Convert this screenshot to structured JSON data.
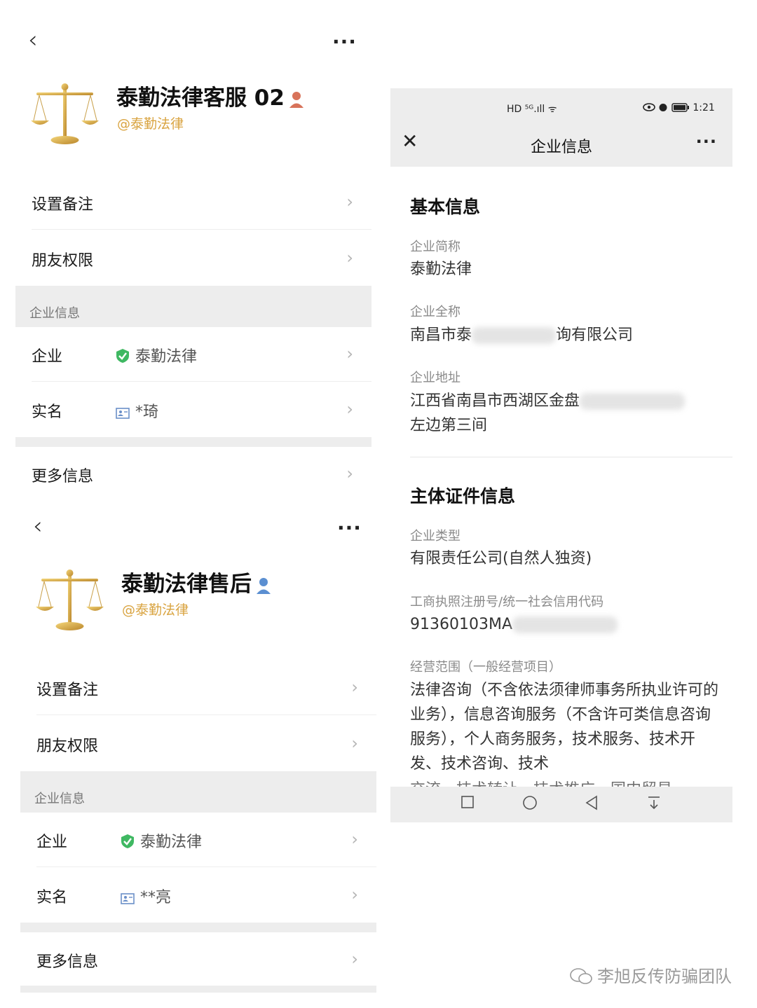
{
  "profiles": [
    {
      "name": "泰勤法律客服 02",
      "handle": "@泰勤法律",
      "gender_icon_color": "#d8735a",
      "rows": {
        "remark": "设置备注",
        "permissions": "朋友权限",
        "section": "企业信息",
        "company_label": "企业",
        "company_value": "泰勤法律",
        "realname_label": "实名",
        "realname_value": "*琦",
        "more": "更多信息"
      }
    },
    {
      "name": "泰勤法律售后",
      "handle": "@泰勤法律",
      "gender_icon_color": "#5b8fd1",
      "rows": {
        "remark": "设置备注",
        "permissions": "朋友权限",
        "section": "企业信息",
        "company_label": "企业",
        "company_value": "泰勤法律",
        "realname_label": "实名",
        "realname_value": "**亮",
        "more": "更多信息"
      }
    }
  ],
  "company_info": {
    "status_time": "1:21",
    "status_left": "HD ⁵ᴳ.ıll ᯤ",
    "title": "企业信息",
    "basic": {
      "title": "基本信息",
      "short_label": "企业简称",
      "short_value": "泰勤法律",
      "full_label": "企业全称",
      "full_value_start": "南昌市泰",
      "full_value_end": "询有限公司",
      "address_label": "企业地址",
      "address_start": "江西省南昌市西湖区金盘",
      "address_line2": "左边第三间"
    },
    "cert": {
      "title": "主体证件信息",
      "type_label": "企业类型",
      "type_value": "有限责任公司(自然人独资)",
      "code_label": "工商执照注册号/统一社会信用代码",
      "code_value_start": "91360103MA",
      "scope_label": "经营范围（一般经营项目）",
      "scope_value": "法律咨询（不含依法须律师事务所执业许可的业务），信息咨询服务（不含许可类信息咨询服务），个人商务服务，技术服务、技术开发、技术咨询、技术",
      "scope_cut": "交流、技术转让、技术推广、国内贸易"
    }
  },
  "colors": {
    "accent_gold": "#d9a441",
    "verified_green": "#3fb862",
    "band_gray": "#ededed"
  },
  "icons": {
    "back": "back-chevron-icon",
    "more": "more-dots-icon",
    "chevron": "chevron-right-icon",
    "verified": "shield-check-icon",
    "realname": "id-card-icon",
    "close": "close-icon"
  },
  "watermark": "李旭反传防骗团队"
}
